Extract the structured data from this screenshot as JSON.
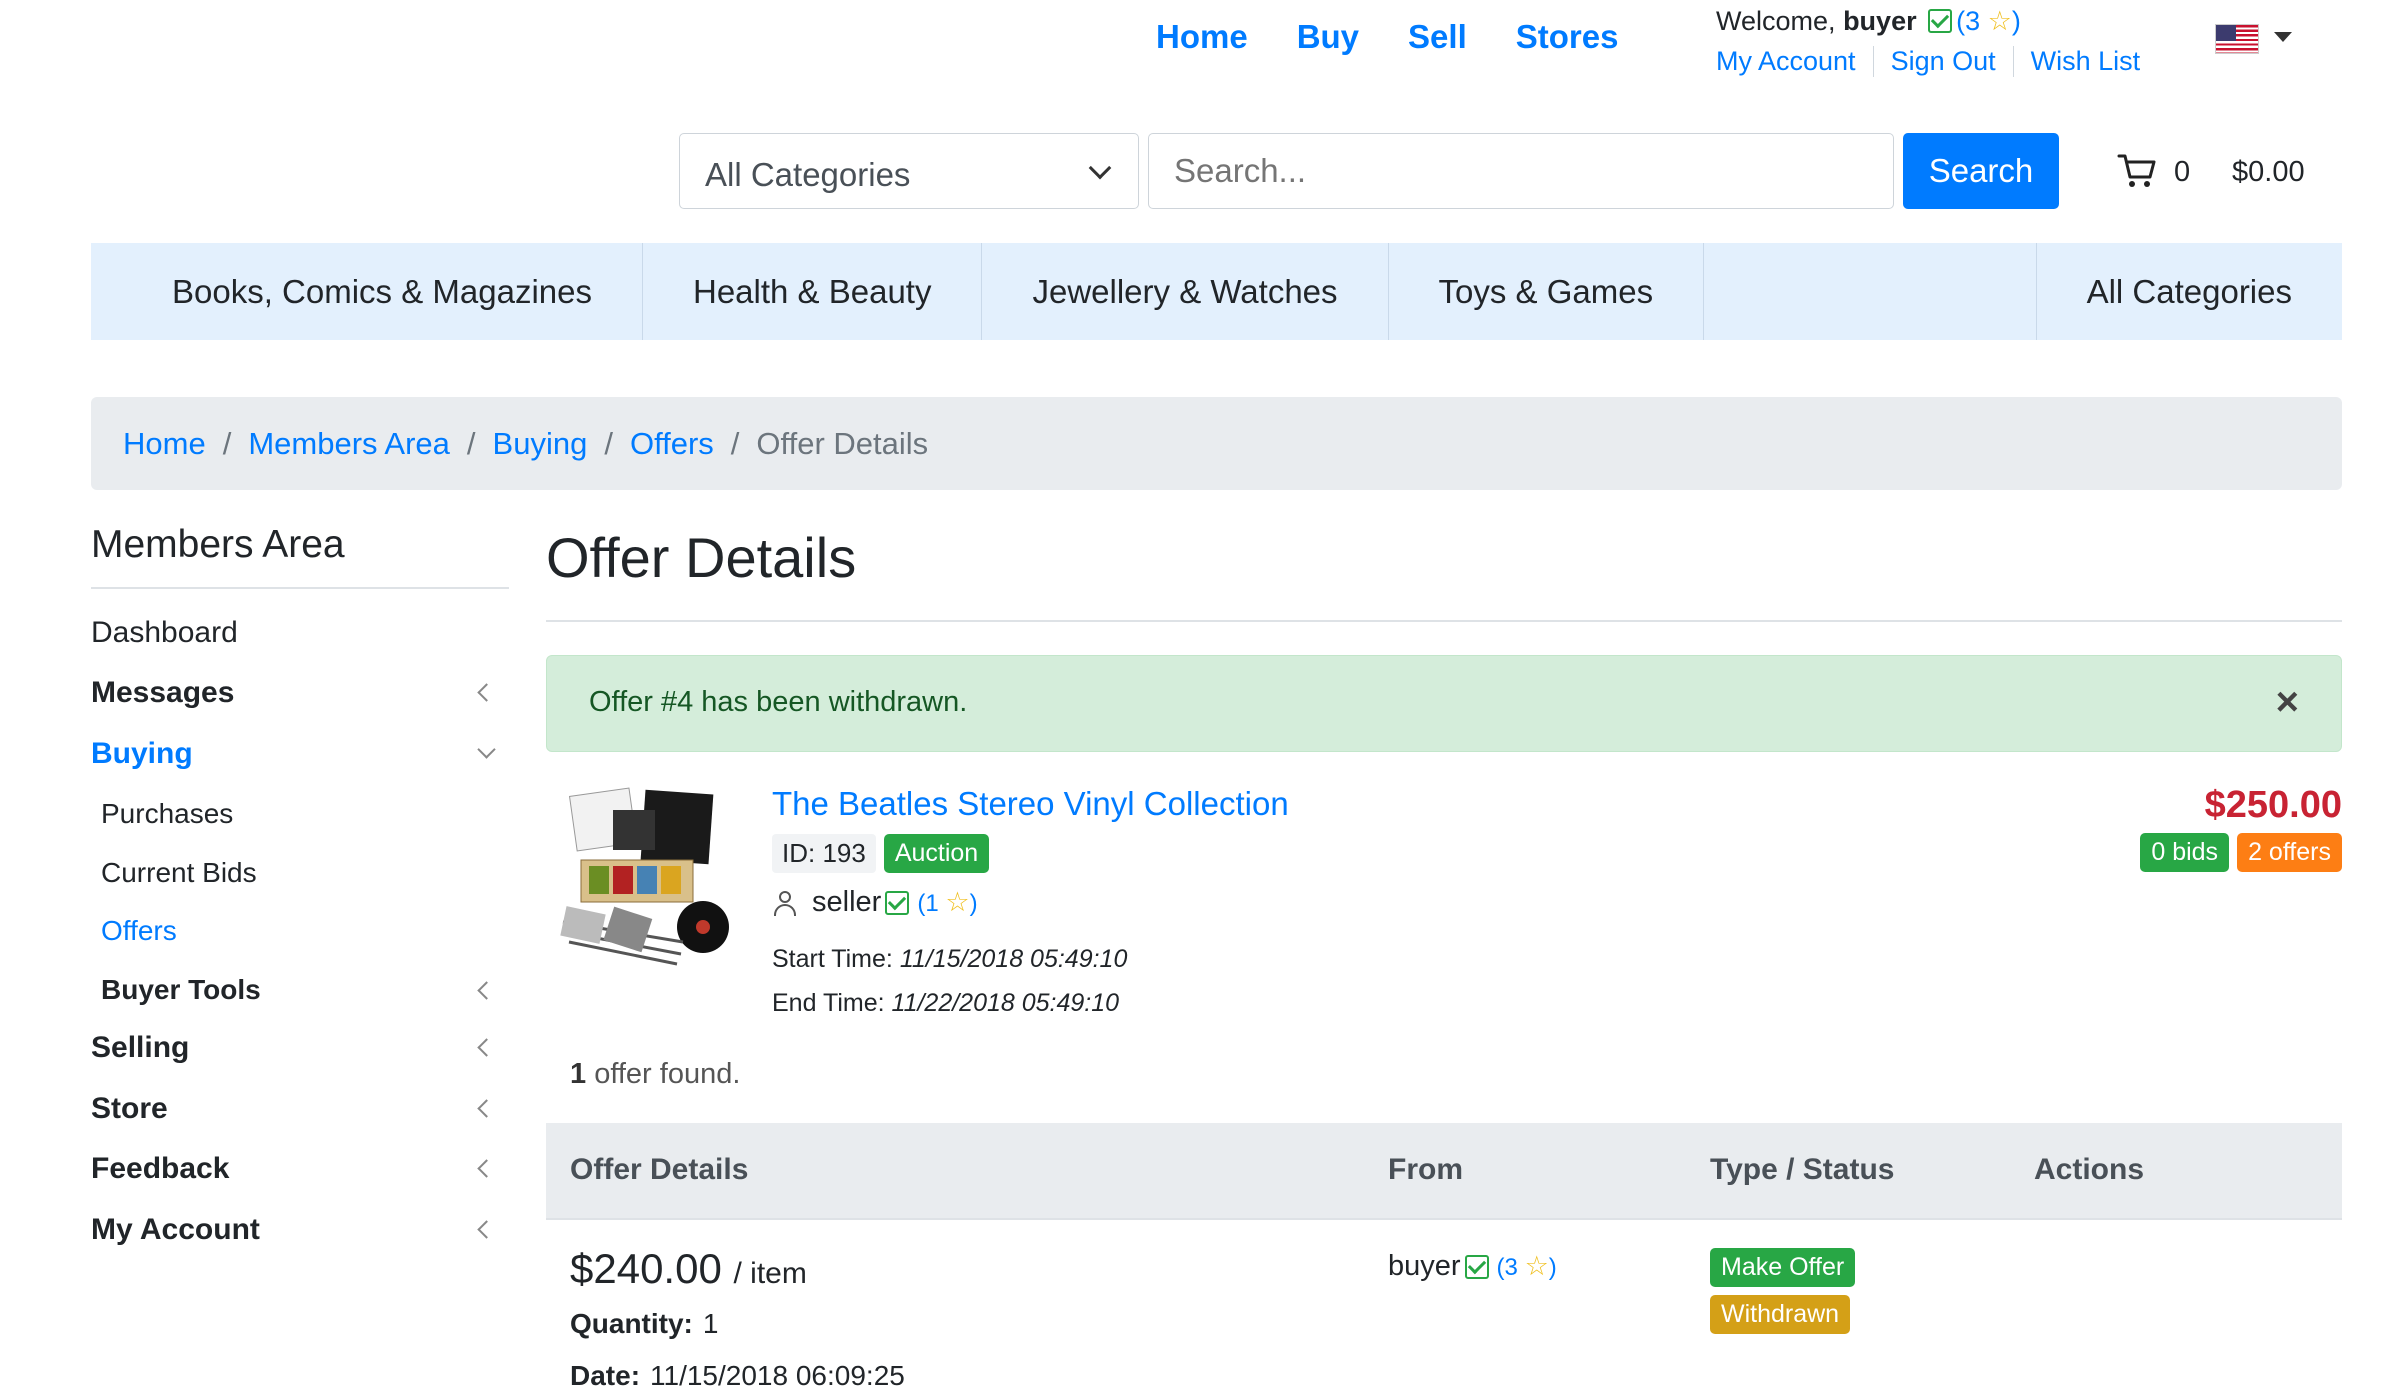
{
  "nav": {
    "links": [
      "Home",
      "Buy",
      "Sell",
      "Stores"
    ]
  },
  "account": {
    "welcome_prefix": "Welcome,",
    "username": "buyer",
    "rating": "3",
    "links": [
      "My Account",
      "Sign Out",
      "Wish List"
    ]
  },
  "search": {
    "category": "All Categories",
    "placeholder": "Search...",
    "button": "Search"
  },
  "cart": {
    "count": "0",
    "total": "$0.00"
  },
  "categories": [
    "Books, Comics & Magazines",
    "Health & Beauty",
    "Jewellery & Watches",
    "Toys & Games",
    "All Categories"
  ],
  "breadcrumb": [
    "Home",
    "Members Area",
    "Buying",
    "Offers",
    "Offer Details"
  ],
  "sidebar": {
    "title": "Members Area",
    "items": [
      "Dashboard",
      "Messages",
      "Buying",
      "Purchases",
      "Current Bids",
      "Offers",
      "Buyer Tools",
      "Selling",
      "Store",
      "Feedback",
      "My Account"
    ]
  },
  "page": {
    "title": "Offer Details"
  },
  "alert": {
    "message": "Offer #4 has been withdrawn.",
    "close": "×"
  },
  "item": {
    "title": "The Beatles Stereo Vinyl Collection",
    "id_label": "ID: 193",
    "type_badge": "Auction",
    "seller": "seller",
    "seller_rating": "1",
    "start_label": "Start Time:",
    "start_time": "11/15/2018 05:49:10",
    "end_label": "End Time:",
    "end_time": "11/22/2018 05:49:10",
    "price": "$250.00",
    "bids": "0 bids",
    "offers": "2 offers"
  },
  "results": {
    "count": "1",
    "text": "offer found."
  },
  "table": {
    "headers": [
      "Offer Details",
      "From",
      "Type / Status",
      "Actions"
    ],
    "rows": [
      {
        "price": "$240.00",
        "unit": "/ item",
        "qty_label": "Quantity:",
        "qty": "1",
        "date_label": "Date:",
        "date": "11/15/2018 06:09:25",
        "from": "buyer",
        "from_rating": "3",
        "type": "Make Offer",
        "status": "Withdrawn"
      }
    ]
  },
  "colors": {
    "primary": "#007bff",
    "success": "#28a745",
    "warning": "#fd7e14",
    "price": "#c82333",
    "alert_bg": "#d4edda"
  }
}
